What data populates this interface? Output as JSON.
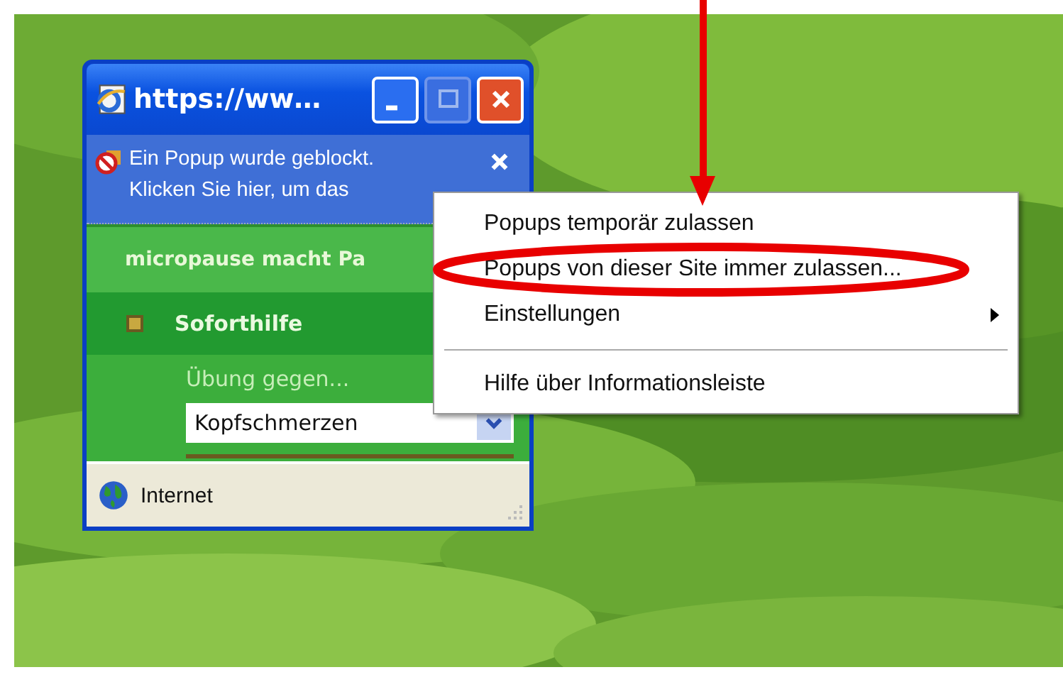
{
  "window": {
    "title": "https://ww…",
    "info_bar": {
      "lines": [
        "Ein Popup wurde geblockt.",
        "Klicken Sie hier, um das"
      ]
    },
    "content": {
      "header": "micropause macht Pa",
      "nav_item": "Soforthilfe",
      "label": "Übung gegen...",
      "select": {
        "value": "Kopfschmerzen"
      }
    },
    "status_bar": {
      "zone": "Internet"
    }
  },
  "context_menu": {
    "items": [
      {
        "kind": "item",
        "label": "Popups temporär zulassen"
      },
      {
        "kind": "item",
        "label": "Popups von dieser Site immer zulassen..."
      },
      {
        "kind": "submenu",
        "label": "Einstellungen"
      },
      {
        "kind": "separator"
      },
      {
        "kind": "item",
        "label": "Hilfe über Informationsleiste"
      }
    ]
  }
}
